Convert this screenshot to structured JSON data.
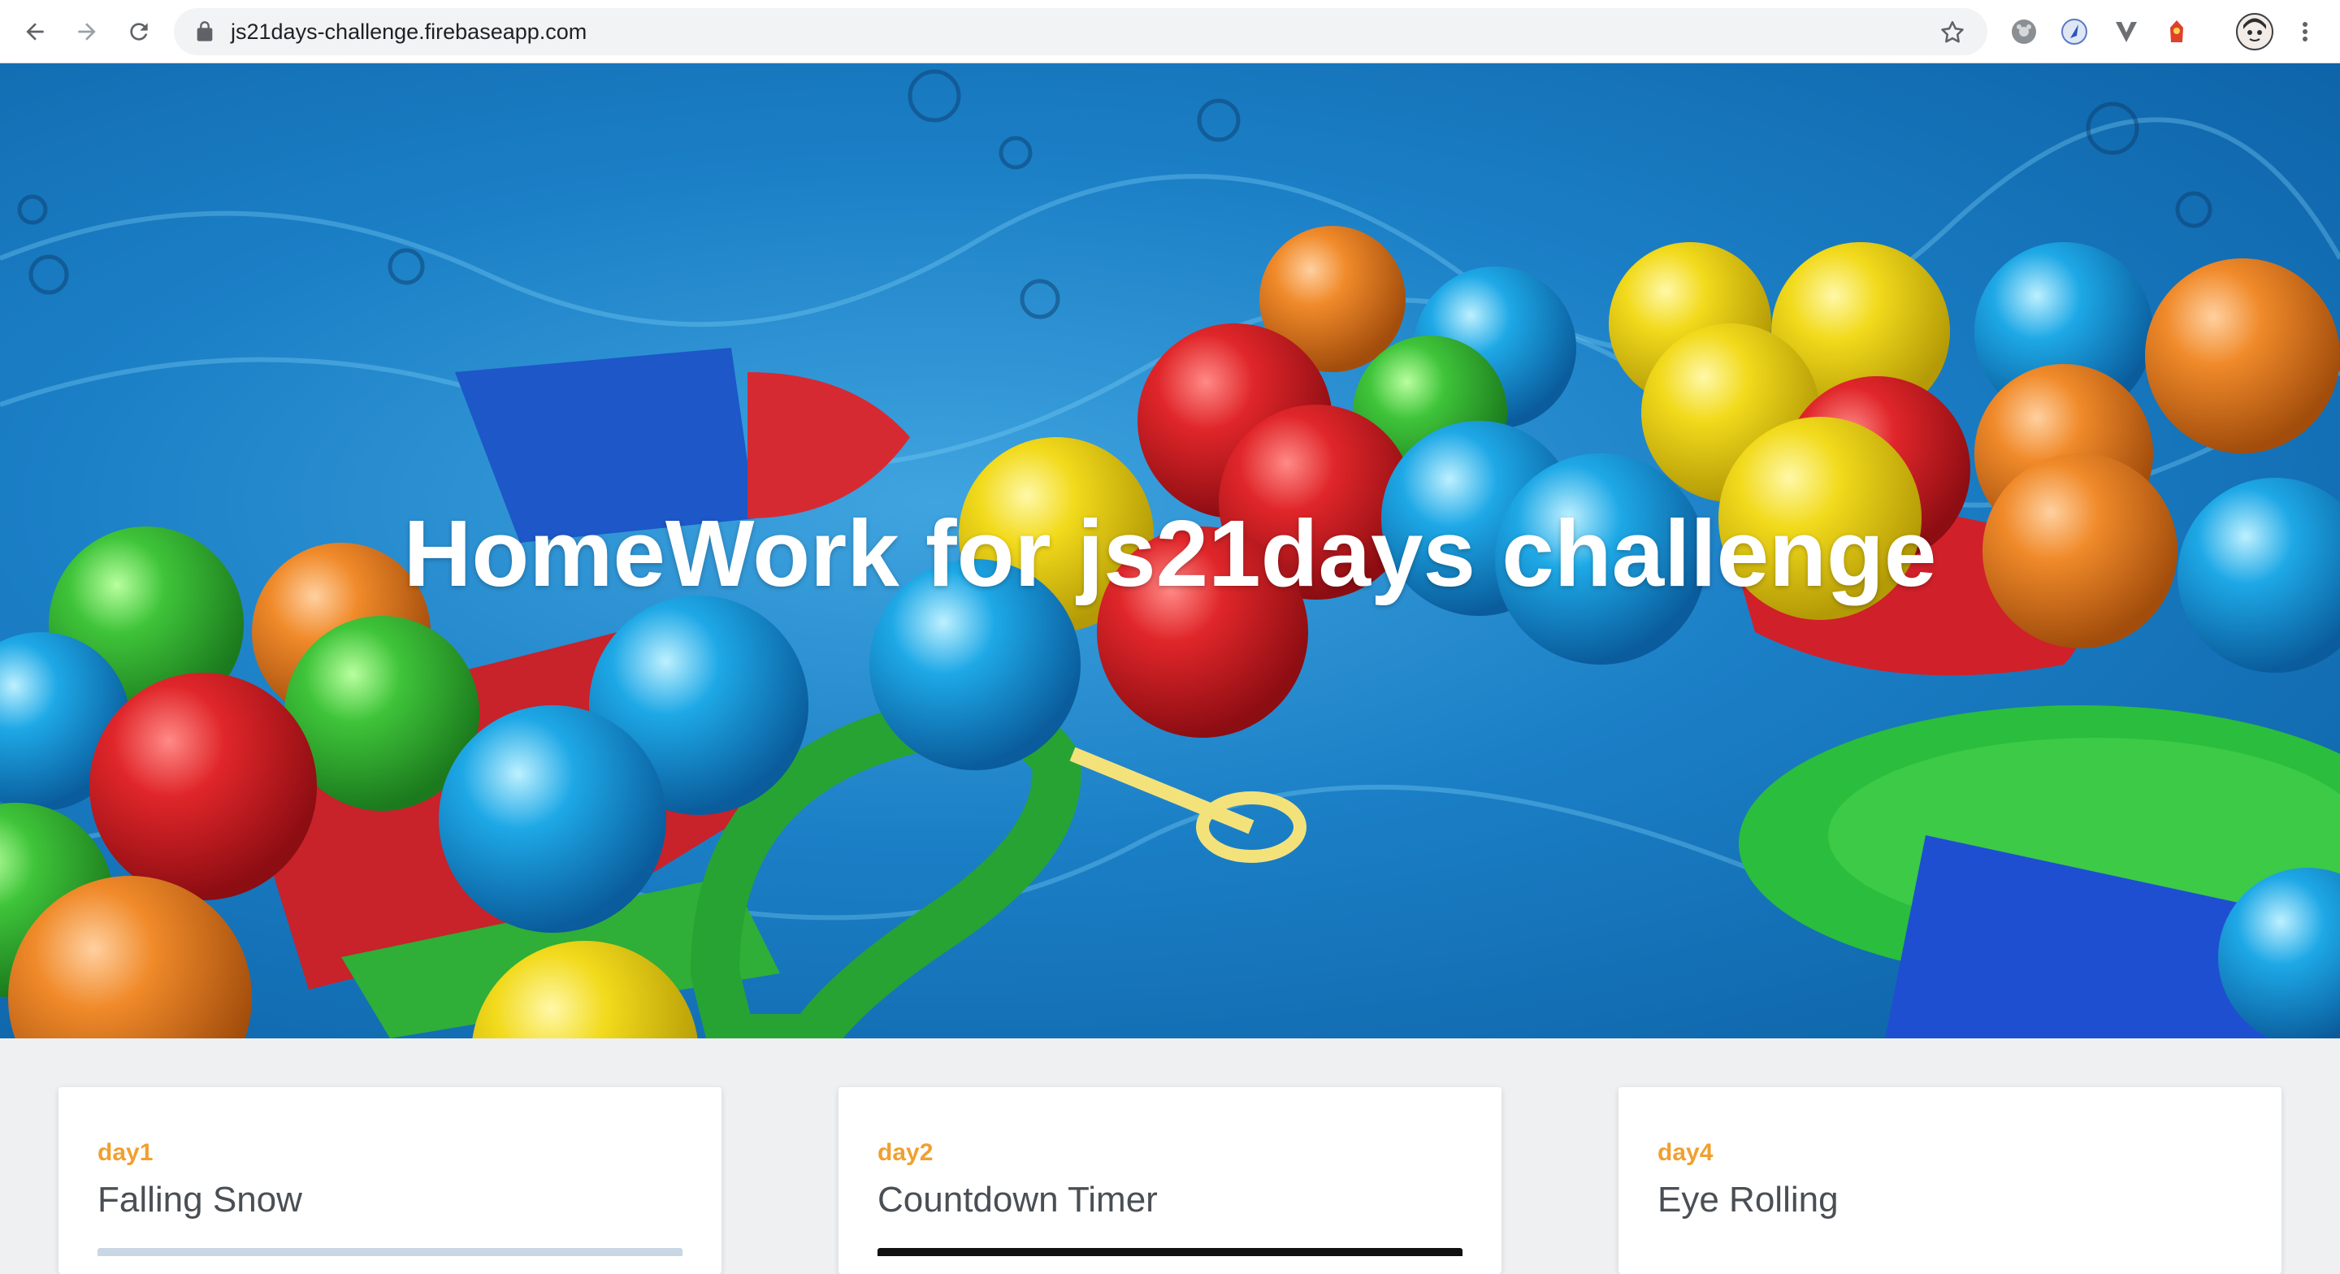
{
  "browser": {
    "url": "js21days-challenge.firebaseapp.com",
    "back_icon": "arrow-left-icon",
    "forward_icon": "arrow-right-icon",
    "reload_icon": "reload-icon",
    "lock_icon": "lock-icon",
    "bookmark_icon": "star-icon",
    "extensions": [
      "extension-gray-icon",
      "extension-blue-icon",
      "extension-v-icon",
      "extension-red-icon"
    ],
    "profile_icon": "avatar-icon",
    "menu_icon": "kebab-menu-icon"
  },
  "hero": {
    "title": "HomeWork for js21days challenge"
  },
  "cards": [
    {
      "day": "day1",
      "name": "Falling Snow",
      "thumb_color": "#c9d6e4"
    },
    {
      "day": "day2",
      "name": "Countdown Timer",
      "thumb_color": "#111111"
    },
    {
      "day": "day4",
      "name": "Eye Rolling",
      "thumb_color": "#ffffff"
    }
  ],
  "colors": {
    "accent": "#f0a030",
    "card_title": "#4a4f55",
    "page_bg": "#eef0f2"
  }
}
